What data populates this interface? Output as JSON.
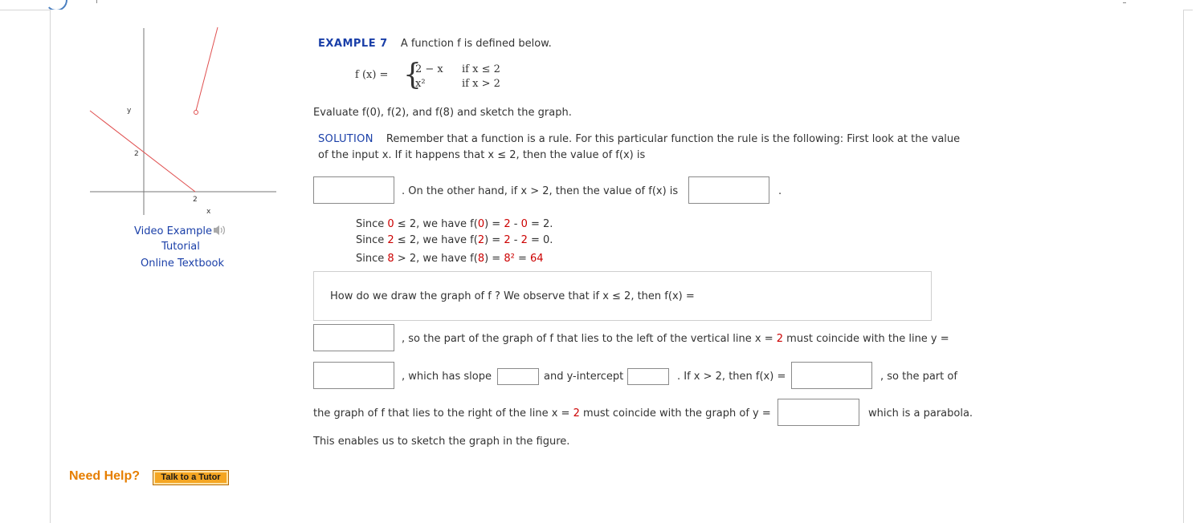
{
  "sidebar": {
    "graph": {
      "y_label": "y",
      "x_label": "x",
      "y_tick": "2",
      "x_tick": "2"
    },
    "links": {
      "video_example": "Video Example",
      "tutorial": "Tutorial",
      "online_textbook": "Online Textbook"
    }
  },
  "example": {
    "label": "EXAMPLE 7",
    "intro": "A function f is defined below.",
    "func_lhs": "f (x) =",
    "case1_expr": "2 − x",
    "case1_cond": "if x ≤ 2",
    "case2_expr": "x²",
    "case2_cond": "if x > 2",
    "evaluate": "Evaluate f(0), f(2), and f(8) and sketch the graph."
  },
  "solution": {
    "label": "SOLUTION",
    "line1": "Remember that a function is a rule. For this particular function the rule is the following: First look at the value",
    "line2": "of the input x. If it happens that x ≤ 2, then the value of f(x) is",
    "line3_mid": ". On the other hand, if x > 2, then the value of f(x) is",
    "line3_end": ".",
    "since": [
      {
        "a": "Since ",
        "b": "0",
        "c": " ≤ 2, we have f(",
        "d": "0",
        "e": ") = ",
        "f": "2",
        "g": " - ",
        "h": "0",
        "i": " = 2."
      },
      {
        "a": "Since ",
        "b": "2",
        "c": " ≤ 2, we have f(",
        "d": "2",
        "e": ") = ",
        "f": "2",
        "g": " - ",
        "h": "2",
        "i": " = 0."
      },
      {
        "a": "Since ",
        "b": "8",
        "c": " > 2, we have f(",
        "d": "8",
        "e": ") = ",
        "f": "8²",
        "g": " = ",
        "h": "64",
        "i": ""
      }
    ],
    "draw_question": "How do we draw the graph of f ? We observe that if x ≤ 2, then f(x) =",
    "left_part": ", so the part of the graph of f that lies to the left of the vertical line x = ",
    "left_part_2": "2",
    "left_part_3": " must coincide with the line y =",
    "slope_text": ", which has slope",
    "yint_text": "and y-intercept",
    "ifx_text": ". If x > 2, then f(x) =",
    "so_part": ", so the part of",
    "right_part_1": "the graph of f that lies to the right of the line x = ",
    "right_part_2": "2",
    "right_part_3": " must coincide with the graph of y =",
    "parabola": "which is a parabola.",
    "closing": "This enables us to sketch the graph in the figure."
  },
  "inputs": {
    "value_le2": "",
    "value_gt2": "",
    "fx_le2": "",
    "line_y": "",
    "slope": "",
    "yintercept": "",
    "fx_gt2": "",
    "graph_y": ""
  },
  "help": {
    "need_help": "Need Help?",
    "talk_to_tutor": "Talk to a Tutor"
  },
  "colors": {
    "link_blue": "#1a3fa8",
    "highlight_red": "#cc0000",
    "help_orange": "#e67e00",
    "graph_line_red": "#e05050"
  }
}
